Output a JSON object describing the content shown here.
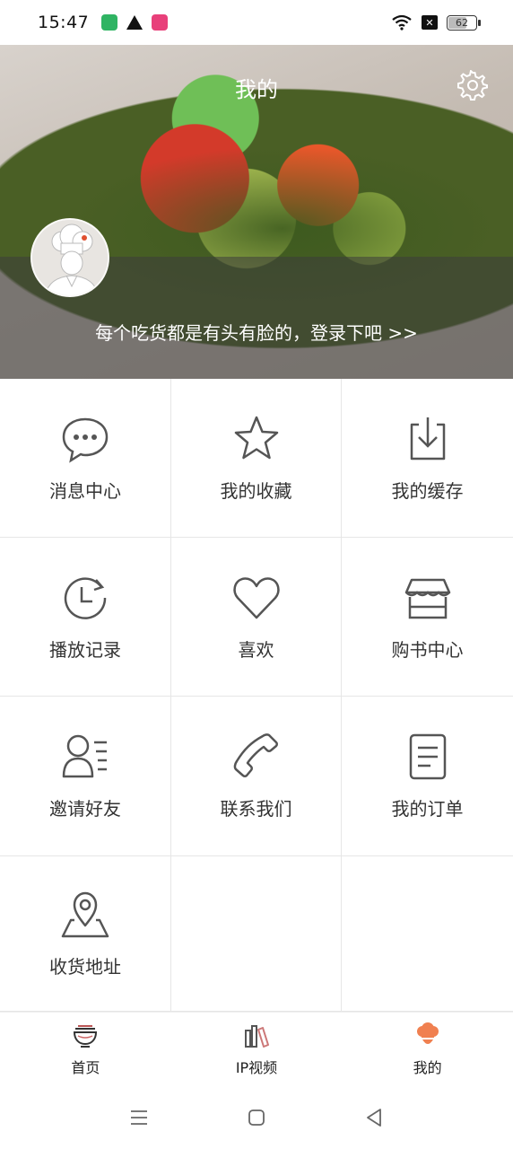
{
  "status_bar": {
    "time": "15:47",
    "battery": "62",
    "icons": [
      "app-notification-icon",
      "warning-icon",
      "app-notification-icon",
      "wifi-icon",
      "no-sim-icon",
      "battery-icon"
    ]
  },
  "header": {
    "title": "我的",
    "login_prompt": "每个吃货都是有头有脸的，登录下吧 >>"
  },
  "menu": {
    "items": [
      {
        "label": "消息中心",
        "icon": "message-icon"
      },
      {
        "label": "我的收藏",
        "icon": "star-icon"
      },
      {
        "label": "我的缓存",
        "icon": "download-icon"
      },
      {
        "label": "播放记录",
        "icon": "history-icon"
      },
      {
        "label": "喜欢",
        "icon": "heart-icon"
      },
      {
        "label": "购书中心",
        "icon": "store-icon"
      },
      {
        "label": "邀请好友",
        "icon": "invite-icon"
      },
      {
        "label": "联系我们",
        "icon": "phone-icon"
      },
      {
        "label": "我的订单",
        "icon": "order-icon"
      },
      {
        "label": "收货地址",
        "icon": "location-icon"
      }
    ]
  },
  "tabbar": {
    "tabs": [
      {
        "label": "首页",
        "icon": "bowl-icon"
      },
      {
        "label": "IP视频",
        "icon": "books-icon"
      },
      {
        "label": "我的",
        "icon": "chef-icon"
      }
    ],
    "active_color": "#f08050"
  },
  "colors": {
    "icon_stroke": "#555555",
    "tab_active": "#f08050"
  }
}
